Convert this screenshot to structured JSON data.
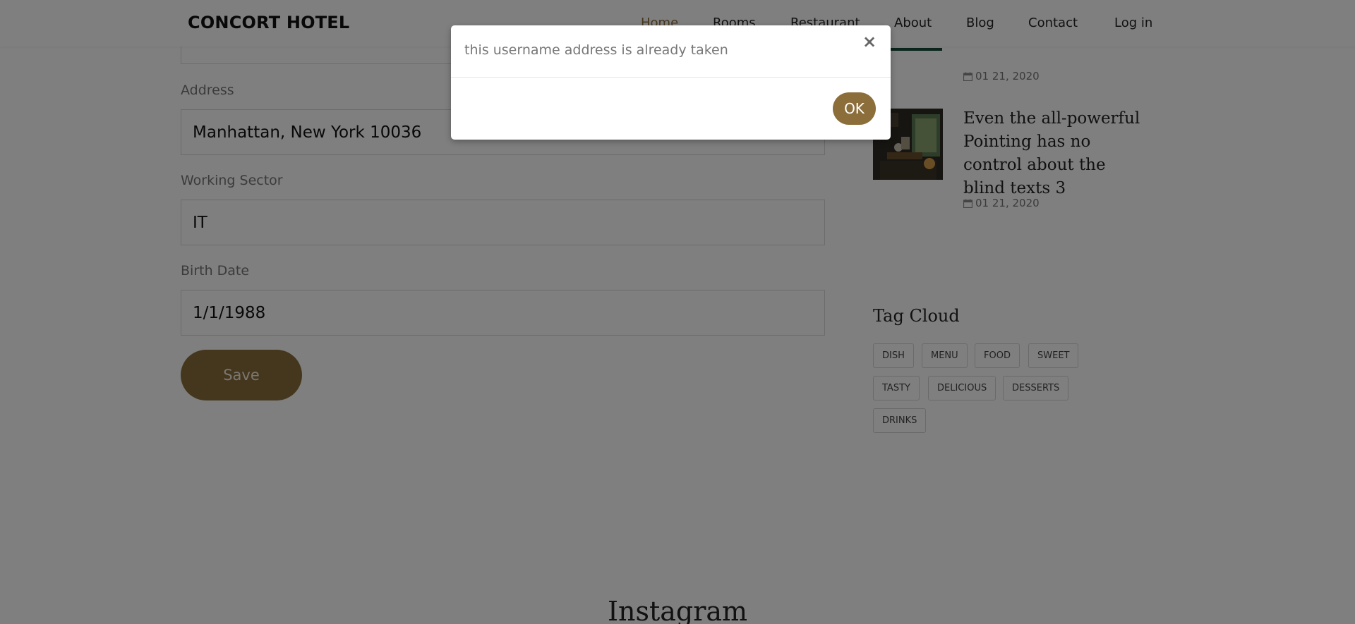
{
  "header": {
    "brand": "CONCORT HOTEL",
    "nav": [
      {
        "label": "Home",
        "active": true
      },
      {
        "label": "Rooms"
      },
      {
        "label": "Restaurant"
      },
      {
        "label": "About"
      },
      {
        "label": "Blog"
      },
      {
        "label": "Contact"
      },
      {
        "label": "Log in"
      }
    ]
  },
  "form": {
    "fields": [
      {
        "label": "Address",
        "value": "Manhattan, New York 10036"
      },
      {
        "label": "Working Sector",
        "value": "IT"
      },
      {
        "label": "Birth Date",
        "value": "1/1/1988"
      }
    ],
    "save_label": "Save"
  },
  "sidebar": {
    "posts": [
      {
        "date": "01 21, 2020"
      },
      {
        "title": "Even the all-powerful Pointing has no control about the blind texts 3",
        "date": "01 21, 2020"
      }
    ],
    "tag_cloud": {
      "heading": "Tag Cloud",
      "tags": [
        "DISH",
        "MENU",
        "FOOD",
        "SWEET",
        "TASTY",
        "DELICIOUS",
        "DESSERTS",
        "DRINKS"
      ]
    }
  },
  "instagram": {
    "heading": "Instagram"
  },
  "modal": {
    "message": "this username address is already taken",
    "close_symbol": "×",
    "ok_label": "OK"
  },
  "colors": {
    "accent": "#8b6e3a",
    "overlay": "rgba(0,0,0,0.5)"
  }
}
